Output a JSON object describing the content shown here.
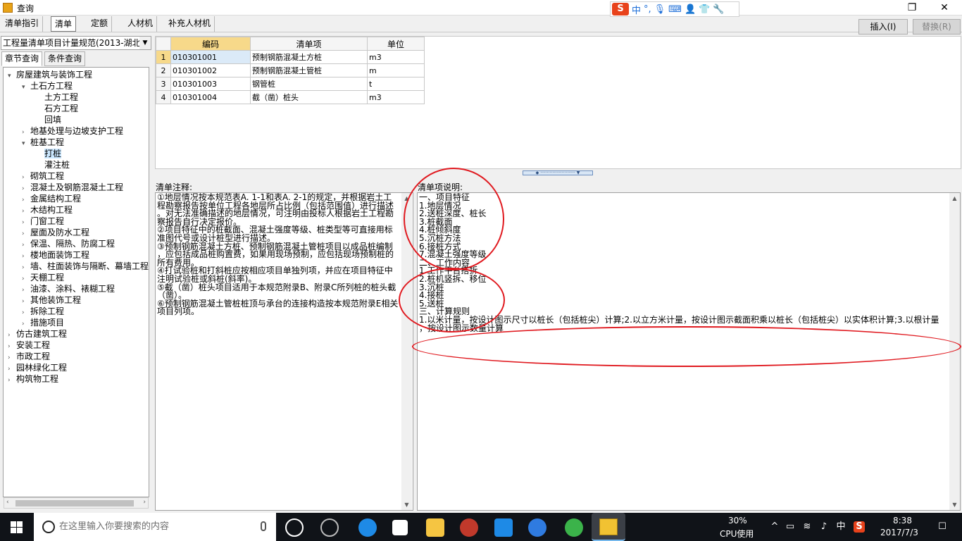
{
  "window": {
    "title": "查询"
  },
  "ime": {
    "logo": "S",
    "mode": "中",
    "punct": "°,"
  },
  "top_tabs": [
    "清单指引",
    "清单",
    "定额",
    "人材机",
    "补充人材机"
  ],
  "active_top_tab": "清单",
  "buttons": {
    "insert": "插入(I)",
    "replace": "替换(R)"
  },
  "spec_select": {
    "value": "工程量清单项目计量规范(2013-湖北"
  },
  "left_tabs": [
    "章节查询",
    "条件查询"
  ],
  "tree": [
    {
      "label": "房屋建筑与装饰工程",
      "level": 0,
      "toggle": "▾"
    },
    {
      "label": "土石方工程",
      "level": 1,
      "toggle": "▾"
    },
    {
      "label": "土方工程",
      "level": 2,
      "toggle": ""
    },
    {
      "label": "石方工程",
      "level": 2,
      "toggle": ""
    },
    {
      "label": "回填",
      "level": 2,
      "toggle": ""
    },
    {
      "label": "地基处理与边坡支护工程",
      "level": 1,
      "toggle": "›"
    },
    {
      "label": "桩基工程",
      "level": 1,
      "toggle": "▾"
    },
    {
      "label": "打桩",
      "level": 2,
      "toggle": "",
      "selected": true
    },
    {
      "label": "灌注桩",
      "level": 2,
      "toggle": ""
    },
    {
      "label": "砌筑工程",
      "level": 1,
      "toggle": "›"
    },
    {
      "label": "混凝土及钢筋混凝土工程",
      "level": 1,
      "toggle": "›"
    },
    {
      "label": "金属结构工程",
      "level": 1,
      "toggle": "›"
    },
    {
      "label": "木结构工程",
      "level": 1,
      "toggle": "›"
    },
    {
      "label": "门窗工程",
      "level": 1,
      "toggle": "›"
    },
    {
      "label": "屋面及防水工程",
      "level": 1,
      "toggle": "›"
    },
    {
      "label": "保温、隔热、防腐工程",
      "level": 1,
      "toggle": "›"
    },
    {
      "label": "楼地面装饰工程",
      "level": 1,
      "toggle": "›"
    },
    {
      "label": "墙、柱面装饰与隔断、幕墙工程",
      "level": 1,
      "toggle": "›"
    },
    {
      "label": "天棚工程",
      "level": 1,
      "toggle": "›"
    },
    {
      "label": "油漆、涂料、裱糊工程",
      "level": 1,
      "toggle": "›"
    },
    {
      "label": "其他装饰工程",
      "level": 1,
      "toggle": "›"
    },
    {
      "label": "拆除工程",
      "level": 1,
      "toggle": "›"
    },
    {
      "label": "措施项目",
      "level": 1,
      "toggle": "›"
    },
    {
      "label": "仿古建筑工程",
      "level": 0,
      "toggle": "›"
    },
    {
      "label": "安装工程",
      "level": 0,
      "toggle": "›"
    },
    {
      "label": "市政工程",
      "level": 0,
      "toggle": "›"
    },
    {
      "label": "园林绿化工程",
      "level": 0,
      "toggle": "›"
    },
    {
      "label": "构筑物工程",
      "level": 0,
      "toggle": "›"
    }
  ],
  "grid": {
    "columns": [
      "编码",
      "清单项",
      "单位"
    ],
    "rows": [
      {
        "n": "1",
        "code": "010301001",
        "item": "预制钢筋混凝土方桩",
        "unit": "m3"
      },
      {
        "n": "2",
        "code": "010301002",
        "item": "预制钢筋混凝土管桩",
        "unit": "m"
      },
      {
        "n": "3",
        "code": "010301003",
        "item": "钢管桩",
        "unit": "t"
      },
      {
        "n": "4",
        "code": "010301004",
        "item": "截（凿）桩头",
        "unit": "m3"
      }
    ]
  },
  "notes_label": "清单注释:",
  "notes_lines": [
    "①地层情况按本规范表A. 1-1和表A. 2-1的规定，并根据岩土工",
    "程勘察报告按单位工程各地层所占比例（包括范围值）进行描述",
    "。对无法准确描述的地层情况，可注明由投标人根据岩土工程勘",
    "察报告自行决定报价。",
    "②项目特征中的桩截面、混凝土强度等级、桩类型等可直接用标",
    "准图代号或设计桩型进行描述。",
    "③预制钢筋混凝土方桩、预制钢筋混凝土管桩项目以成品桩编制",
    "，应包括成品桩购置费，如果用现场预制，应包括现场预制桩的",
    "所有费用。",
    "④打试验桩和打斜桩应按相应项目单独列项，并应在项目特征中",
    "注明试验桩或斜桩(斜率)。",
    "⑤截（凿）桩头项目适用于本规范附录B、附录C所列桩的桩头截",
    "（凿）。",
    "⑥预制钢筋混凝土管桩桩顶与承台的连接构造按本规范附录E相关",
    "项目列项。"
  ],
  "desc_label": "清单项说明:",
  "desc_lines": [
    "一、项目特征",
    "1.地层情况",
    "2.送桩深度、桩长",
    "3.桩截面",
    "4.桩倾斜度",
    "5.沉桩方法",
    "6.接桩方式",
    "7.混凝土强度等级",
    "二、工作内容",
    "1.工作平台搭拆",
    "2.桩机竖拆、移位",
    "3.沉桩",
    "4.接桩",
    "5.送桩",
    "三、计算规则",
    "1.以米计量，按设计图示尺寸以桩长（包括桩尖）计算;2.以立方米计量，按设计图示截面积乘以桩长（包括桩尖）以实体积计算;3.以根计量",
    "，按设计图示数量计算"
  ],
  "taskbar": {
    "search_placeholder": "在这里输入你要搜索的内容",
    "cpu_percent": "30%",
    "cpu_label": "CPU使用",
    "ime_mode": "中",
    "time": "8:38",
    "date": "2017/7/3"
  },
  "colors": {
    "selected_header": "#f7d98a",
    "annotation_red": "#e0191f",
    "taskbar_bg": "#101318"
  }
}
